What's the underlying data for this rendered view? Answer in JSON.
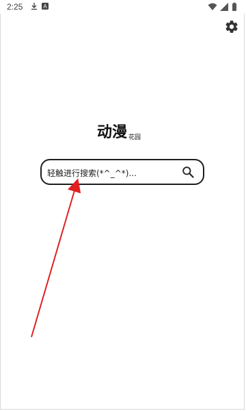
{
  "status_bar": {
    "time": "2:25",
    "icons": [
      "download-icon",
      "a-icon",
      "wifi-icon",
      "signal-icon",
      "battery-icon"
    ]
  },
  "header": {
    "settings_icon": "gear-icon"
  },
  "brand": {
    "title": "动漫",
    "subtitle": "花园"
  },
  "search": {
    "placeholder": "轻触进行搜索(*^_^*)...",
    "search_icon": "search-icon"
  },
  "annotation": {
    "color": "#e02020"
  }
}
